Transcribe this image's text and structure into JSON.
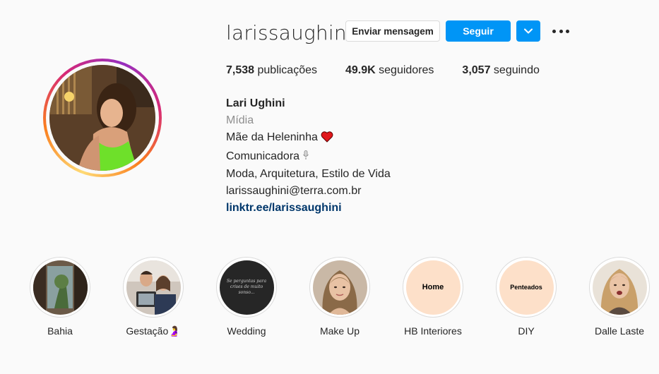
{
  "profile": {
    "username": "larissaughini",
    "message_label": "Enviar mensagem",
    "follow_label": "Seguir",
    "stats": {
      "posts_count": "7,538",
      "posts_label": " publicações",
      "followers_count": "49.9K",
      "followers_label": " seguidores",
      "following_count": "3,057",
      "following_label": " seguindo"
    },
    "bio": {
      "name": "Lari Ughini",
      "category": "Mídia",
      "line1": "Mãe da Heleninha",
      "line2": "Comunicadora",
      "line3": "Moda, Arquitetura, Estilo de Vida",
      "email": "larissaughini@terra.com.br",
      "link": "linktr.ee/larissaughini"
    }
  },
  "highlights": [
    {
      "label": "Bahia"
    },
    {
      "label": "Gestação🤰"
    },
    {
      "label": "Wedding",
      "cover_text": "Se perguntas para crises de muito sonso..."
    },
    {
      "label": "Make Up"
    },
    {
      "label": "HB Interiores",
      "cover_text": "Home"
    },
    {
      "label": "DIY",
      "cover_text": "Penteados"
    },
    {
      "label": "Dalle Laste"
    }
  ],
  "colors": {
    "primary_blue": "#0095f6",
    "link": "#00376b",
    "secondary_text": "#8e8e8e",
    "peach_cover": "#fde0c9",
    "dark_cover": "#262626"
  }
}
